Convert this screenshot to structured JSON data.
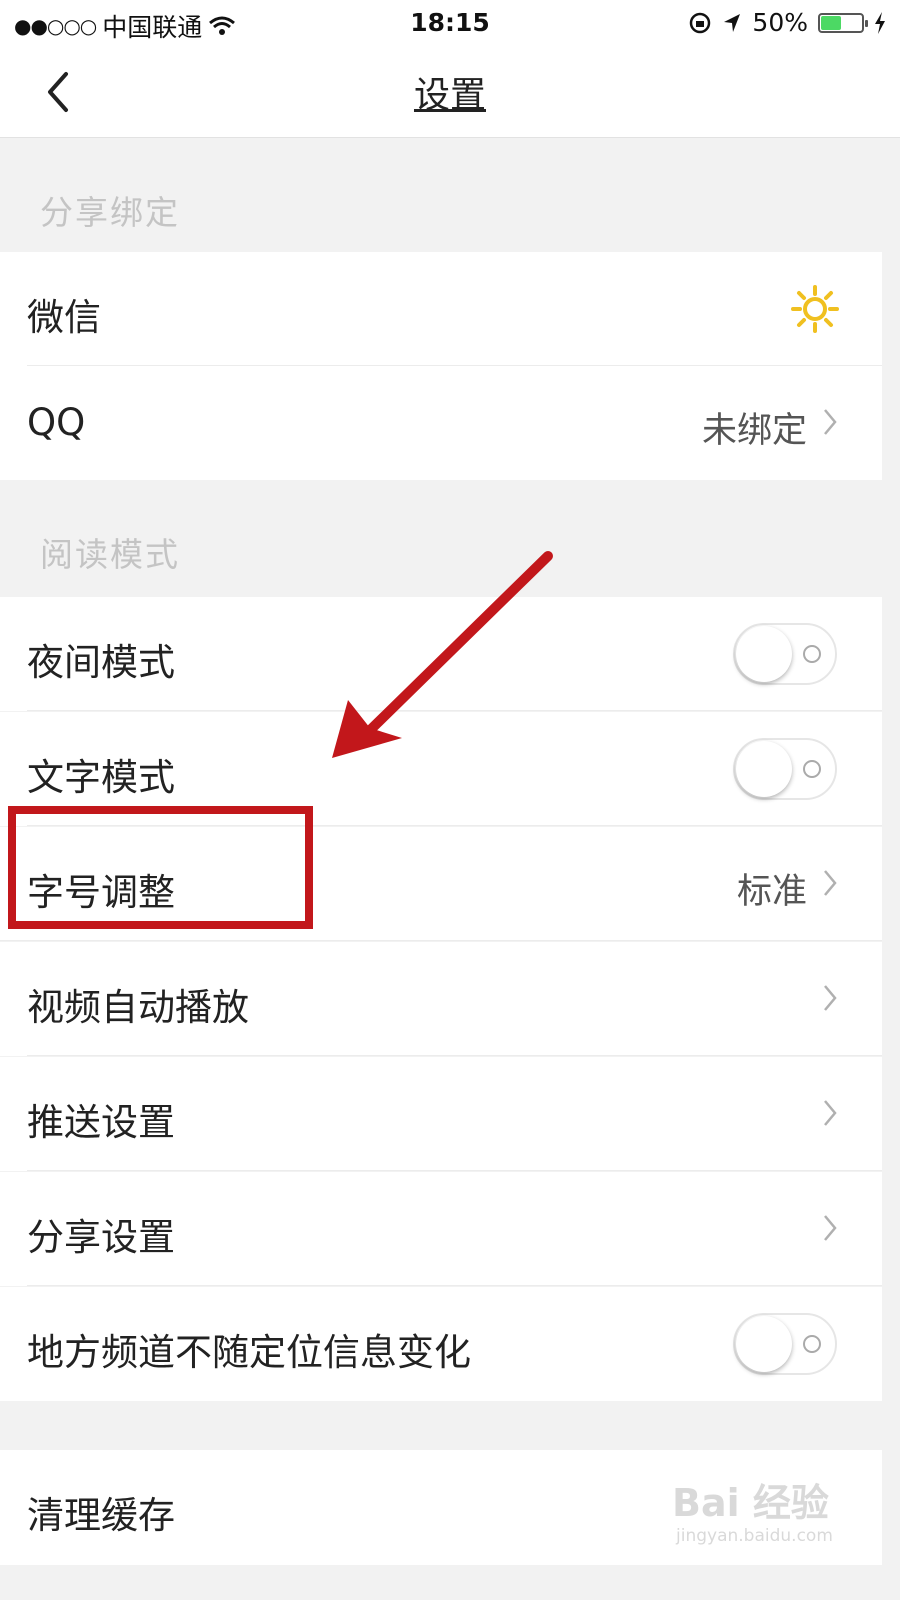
{
  "status_bar": {
    "signal_dots": "●●○○○",
    "carrier": "中国联通",
    "time": "18:15",
    "battery_percent": "50%",
    "battery_level": 0.5,
    "battery_color": "#4cd964"
  },
  "nav": {
    "back_icon": "chevron-left-icon",
    "title": "设置"
  },
  "sections": {
    "share_binding": {
      "header": "分享绑定",
      "wechat_label": "微信",
      "wechat_icon": "sun-icon",
      "qq_label": "QQ",
      "qq_value": "未绑定"
    },
    "reading_mode": {
      "header": "阅读模式",
      "night_mode_label": "夜间模式",
      "night_mode_on": false,
      "text_mode_label": "文字模式",
      "text_mode_on": false,
      "font_size_label": "字号调整",
      "font_size_value": "标准",
      "video_autoplay_label": "视频自动播放",
      "push_settings_label": "推送设置",
      "share_settings_label": "分享设置",
      "local_channel_label": "地方频道不随定位信息变化",
      "local_channel_on": false
    },
    "cache": {
      "clear_cache_label": "清理缓存"
    }
  },
  "annotation": {
    "highlight_color": "#c2171b"
  },
  "watermark": {
    "logo_text": "Bai 经验",
    "url": "jingyan.baidu.com"
  }
}
